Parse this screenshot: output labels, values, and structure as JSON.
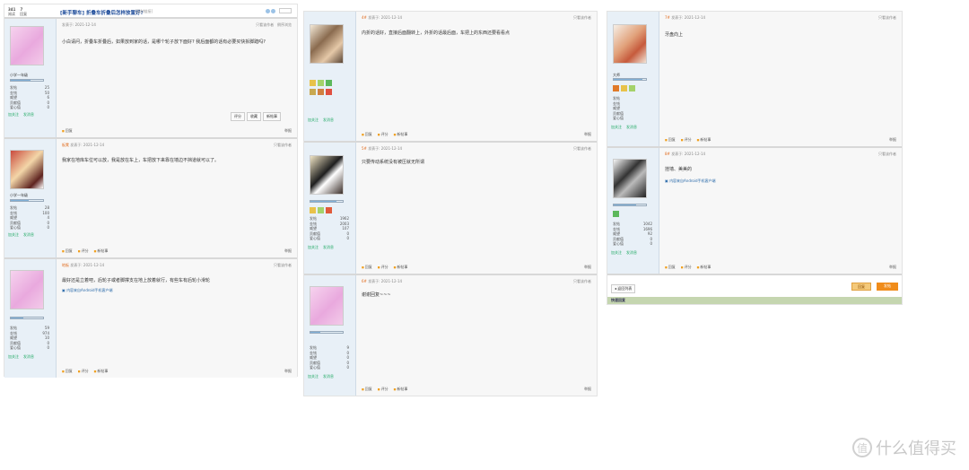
{
  "thread": {
    "replies": "341",
    "replies_label": "阅读",
    "reply_count": "7",
    "reply_count_label": "回复",
    "title": "[新手聊车] 折叠车折叠后怎样放置好?",
    "subtitle": "[复制链接]"
  },
  "post_labels": {
    "posted_at": "发表于: 2021-12-14",
    "only_author": "只看该作者",
    "only_author_lz": "只看该作者",
    "print": "倒序浏览",
    "reply": "回复",
    "rate": "评分",
    "report": "举报",
    "add_friend": "加关注",
    "send_msg": "发消息",
    "new_tag": "新帖事"
  },
  "posts": [
    {
      "floor": "沙发",
      "user": "小学一年级",
      "stats": [
        [
          "发帖",
          "25"
        ],
        [
          "金钱",
          "50"
        ],
        [
          "威望",
          "6"
        ],
        [
          "贡献值",
          "0"
        ],
        [
          "爱心值",
          "0"
        ]
      ],
      "text": "小白请问，折叠车折叠后，如果放到家的话，是哪个轮子放下面好? 我后面都的话有必要买快拆脚踏吗?"
    },
    {
      "floor": "板凳",
      "user": "小学一年级",
      "stats": [
        [
          "发帖",
          "28"
        ],
        [
          "金钱",
          "100"
        ],
        [
          "威望",
          "4"
        ],
        [
          "贡献值",
          "0"
        ],
        [
          "爱心值",
          "0"
        ]
      ],
      "text": "我家在地库车位可以放，我是放在车上，车把放下来靠在墙边不挡道就可以了。"
    },
    {
      "floor": "地板",
      "user": "",
      "stats": [
        [
          "发帖",
          "59"
        ],
        [
          "金钱",
          "974"
        ],
        [
          "威望",
          "10"
        ],
        [
          "贡献值",
          "0"
        ],
        [
          "爱心值",
          "0"
        ]
      ],
      "text": "最好还是立着吧，后轮子或者脚撑支在地上放着就行，有些车有后轮小滑轮",
      "sig": "内容来自Android手机客户端"
    },
    {
      "floor": "4#",
      "user": "",
      "stats": [],
      "text": "内折的话好，直接后面翻转上，外折的话最后面，车把上的东西还要看看点"
    },
    {
      "floor": "5#",
      "user": "",
      "stats": [
        [
          "发帖",
          "1962"
        ],
        [
          "金钱",
          "2003"
        ],
        [
          "威望",
          "107"
        ],
        [
          "贡献值",
          "0"
        ],
        [
          "爱心值",
          "0"
        ]
      ],
      "text": "只要传动系统没有被压就无所谓"
    },
    {
      "floor": "6#",
      "user": "",
      "stats": [
        [
          "发帖",
          "9"
        ],
        [
          "金钱",
          "0"
        ],
        [
          "威望",
          "0"
        ],
        [
          "贡献值",
          "0"
        ],
        [
          "爱心值",
          "0"
        ]
      ],
      "text": "谢谢回复~~~"
    },
    {
      "floor": "7#",
      "user": "大师",
      "stats": [
        [
          "发帖",
          ""
        ],
        [
          "金钱",
          ""
        ],
        [
          "威望",
          ""
        ],
        [
          "贡献值",
          ""
        ],
        [
          "爱心值",
          ""
        ]
      ],
      "text": "牙盘向上"
    },
    {
      "floor": "8#",
      "user": "",
      "stats": [
        [
          "发帖",
          "1042"
        ],
        [
          "金钱",
          "1696"
        ],
        [
          "威望",
          "92"
        ],
        [
          "贡献值",
          "0"
        ],
        [
          "爱心值",
          "0"
        ]
      ],
      "text": "挂墙、美美的",
      "sig": "内容来自Android手机客户端"
    }
  ],
  "bottom": {
    "back_list": "◂ 返回列表",
    "reply_btn": "回复",
    "post_btn": "发帖",
    "quick_reply": "快速回复"
  },
  "watermark": "什么值得买",
  "colors": {
    "accent": "#f08c1a",
    "sidebar": "#e8f0f7",
    "title": "#1e4c9a"
  }
}
